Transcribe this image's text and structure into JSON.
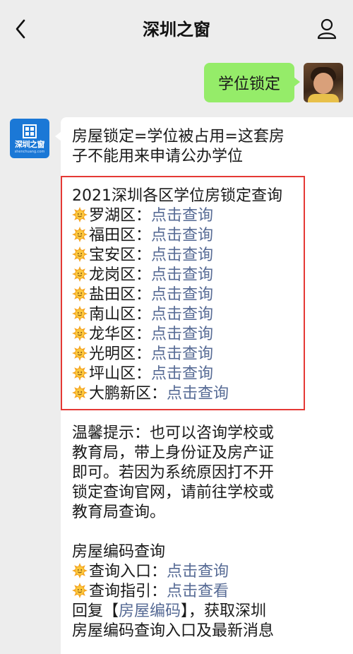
{
  "header": {
    "title": "深圳之窗"
  },
  "outgoing": {
    "message": "学位锁定"
  },
  "bot": {
    "logo_text": "深圳之窗",
    "logo_sub": "shenchuang.com"
  },
  "message": {
    "intro_line1": "房屋锁定=学位被占用=这套房",
    "intro_line2": "子不能用来申请公办学位",
    "query_title": "2021深圳各区学位房锁定查询",
    "districts": [
      {
        "name": "罗湖区：",
        "link": "点击查询"
      },
      {
        "name": "福田区：",
        "link": "点击查询"
      },
      {
        "name": "宝安区：",
        "link": "点击查询"
      },
      {
        "name": "龙岗区：",
        "link": "点击查询"
      },
      {
        "name": "盐田区：",
        "link": "点击查询"
      },
      {
        "name": "南山区：",
        "link": "点击查询"
      },
      {
        "name": "龙华区：",
        "link": "点击查询"
      },
      {
        "name": "光明区：",
        "link": "点击查询"
      },
      {
        "name": "坪山区：",
        "link": "点击查询"
      },
      {
        "name": "大鹏新区：",
        "link": "点击查询"
      }
    ],
    "tip_lines": [
      "温馨提示：也可以咨询学校或",
      "教育局，带上身份证及房产证",
      "即可。若因为系统原因打不开",
      "锁定查询官网，请前往学校或",
      "教育局查询。"
    ],
    "house_code_title": "房屋编码查询",
    "house_code_entry_label": "查询入口：",
    "house_code_entry_link": "点击查询",
    "house_code_guide_label": "查询指引：",
    "house_code_guide_link": "点击查看",
    "reply_prefix": "回复【",
    "reply_keyword": "房屋编码",
    "reply_suffix": "】，获取深圳",
    "reply_line2": "房屋编码查询入口及最新消息"
  }
}
